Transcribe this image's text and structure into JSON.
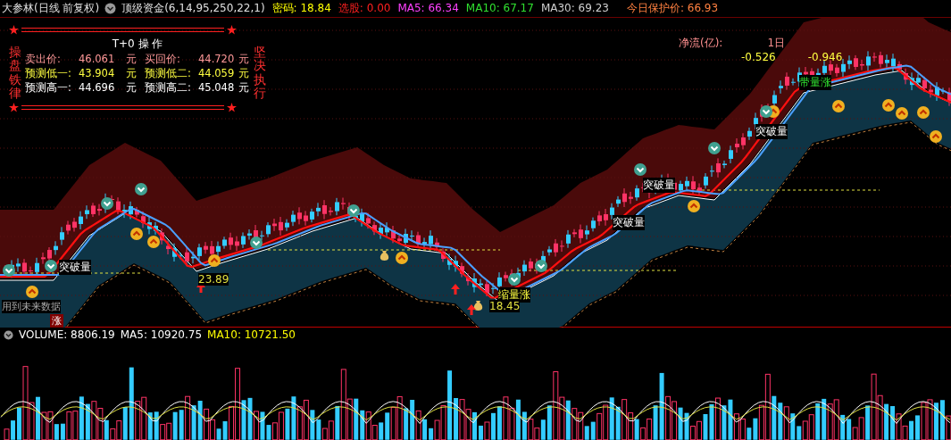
{
  "header": {
    "title": "大参林(日线 前复权)",
    "indicator": "顶级资金(6,14,95,250,22,1)",
    "values": [
      {
        "label": "密码:",
        "value": "18.84",
        "color": "#ffff00"
      },
      {
        "label": "选股:",
        "value": "0.00",
        "color": "#ff2020"
      },
      {
        "label": "MA5:",
        "value": "66.34",
        "color": "#ff40ff"
      },
      {
        "label": "MA10:",
        "value": "67.17",
        "color": "#30e030"
      },
      {
        "label": "MA30:",
        "value": "69.23",
        "color": "#d0d0d0"
      },
      {
        "label": "今日保护价:",
        "value": "66.93",
        "color": "#ff8040"
      }
    ]
  },
  "t0_panel": {
    "title": "T+0 操 作",
    "left_motto": "操盘铁律",
    "right_motto": "坚决执行",
    "rows": [
      {
        "color": "#ff9999",
        "cells": [
          {
            "label": "卖出价:",
            "value": "46.061",
            "unit": "元"
          },
          {
            "label": "买回价:",
            "value": "44.720",
            "unit": "元"
          }
        ]
      },
      {
        "color": "#ffff40",
        "cells": [
          {
            "label": "预测低一:",
            "value": "43.904",
            "unit": "元"
          },
          {
            "label": "预测低二:",
            "value": "44.059",
            "unit": "元"
          }
        ]
      },
      {
        "color": "#ffffff",
        "cells": [
          {
            "label": "预测高一:",
            "value": "44.696",
            "unit": "元"
          },
          {
            "label": "预测高二:",
            "value": "45.048",
            "unit": "元"
          }
        ]
      }
    ]
  },
  "net_flow": {
    "label": "净流(亿):",
    "period": "1日",
    "values": [
      "-0.526",
      "-0.946"
    ]
  },
  "annotations": [
    {
      "text": "突破量",
      "kind": "signal"
    },
    {
      "text": "突破量",
      "kind": "signal"
    },
    {
      "text": "突破量",
      "kind": "signal"
    },
    {
      "text": "突破量",
      "kind": "signal"
    },
    {
      "text": "带量涨",
      "kind": "rise"
    },
    {
      "text": "缩量涨",
      "kind": "shrink"
    },
    {
      "text": "23.89",
      "kind": "price"
    },
    {
      "text": "18.45",
      "kind": "price"
    },
    {
      "text": "用到未来数据",
      "kind": "note"
    },
    {
      "text": "涨",
      "kind": "tag"
    }
  ],
  "volume": {
    "values": [
      {
        "label": "VOLUME:",
        "value": "8806.19",
        "color": "#ffffff"
      },
      {
        "label": "MA5:",
        "value": "10920.75",
        "color": "#ffffff"
      },
      {
        "label": "MA10:",
        "value": "10721.50",
        "color": "#ffff00"
      }
    ]
  }
}
